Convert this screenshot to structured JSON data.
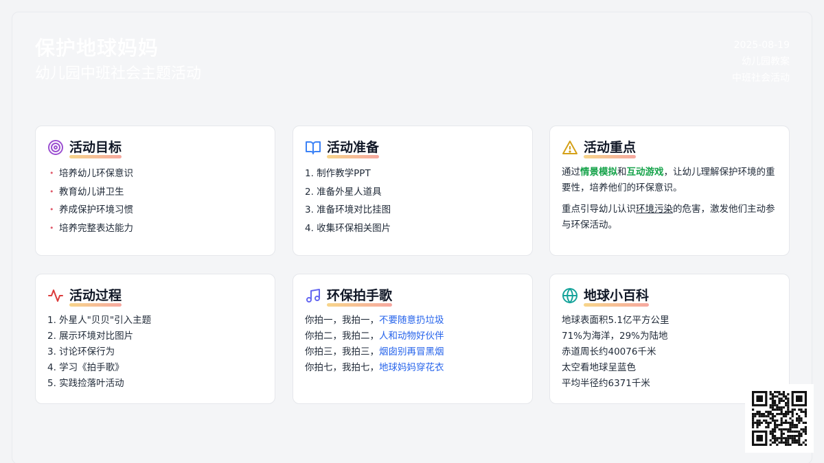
{
  "header": {
    "title": "保护地球妈妈",
    "subtitle": "幼儿园中班社会主题活动",
    "date": "2025-08-19",
    "tag1": "幼儿园教案",
    "tag2": "中班社会活动"
  },
  "cards": {
    "goals": {
      "icon": "target-icon",
      "title": "活动目标",
      "items": [
        "培养幼儿环保意识",
        "教育幼儿讲卫生",
        "养成保护环境习惯",
        "培养完整表达能力"
      ]
    },
    "prep": {
      "icon": "book-open-icon",
      "title": "活动准备",
      "items": [
        "1. 制作教学PPT",
        "2. 准备外星人道具",
        "3. 准备环境对比挂图",
        "4. 收集环保相关图片"
      ]
    },
    "focus": {
      "icon": "warning-icon",
      "title": "活动重点",
      "p1_a": "通过",
      "p1_b": "情景模拟",
      "p1_c": "和",
      "p1_d": "互动游戏",
      "p1_e": "，让幼儿理解保护环境的重要性，培养他们的环保意识。",
      "p2_a": "重点引导幼儿认识",
      "p2_b": "环境污染",
      "p2_c": "的危害，激发他们主动参与环保活动。"
    },
    "process": {
      "icon": "activity-icon",
      "title": "活动过程",
      "items": [
        "1. 外星人\"贝贝\"引入主题",
        "2. 展示环境对比图片",
        "3. 讨论环保行为",
        "4. 学习《拍手歌》",
        "5. 实践捡落叶活动"
      ]
    },
    "song": {
      "icon": "music-note-icon",
      "title": "环保拍手歌",
      "lines": [
        {
          "lead": "你拍一，我拍一，",
          "text": "不要随意扔垃圾"
        },
        {
          "lead": "你拍二，我拍二，",
          "text": "人和动物好伙伴"
        },
        {
          "lead": "你拍三，我拍三，",
          "text": "烟囱别再冒黑烟"
        },
        {
          "lead": "你拍七，我拍七，",
          "text": "地球妈妈穿花衣"
        }
      ]
    },
    "earth": {
      "icon": "globe-icon",
      "title": "地球小百科",
      "items": [
        "地球表面积5.1亿平方公里",
        "71%为海洋，29%为陆地",
        "赤道周长约40076千米",
        "太空看地球呈蓝色",
        "平均半径约6371千米"
      ]
    }
  },
  "qr": {
    "icon": "qr-code-icon"
  }
}
